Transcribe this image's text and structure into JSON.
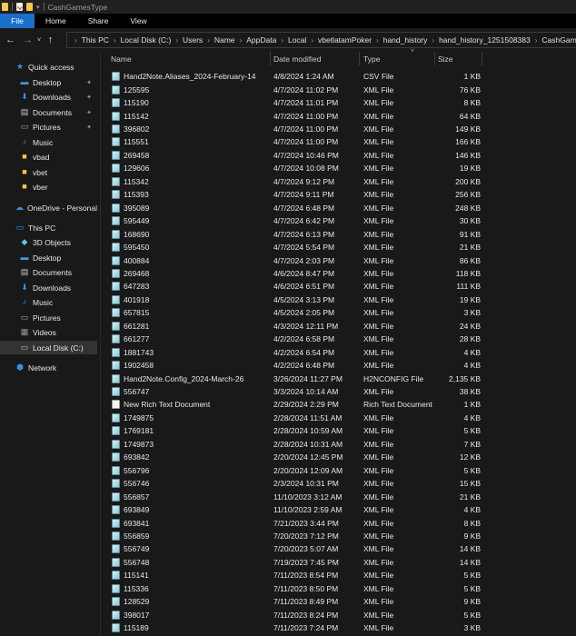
{
  "window": {
    "title": "CashGamesType"
  },
  "ribbon": {
    "tabs": [
      "File",
      "Home",
      "Share",
      "View"
    ]
  },
  "address": {
    "crumbs": [
      "This PC",
      "Local Disk (C:)",
      "Users",
      "Name",
      "AppData",
      "Local",
      "vbetlatamPoker",
      "hand_history",
      "hand_history_1251508383",
      "CashGamesType"
    ]
  },
  "sidebar": {
    "items": [
      {
        "label": "Quick access",
        "icon": "star-icon",
        "level": 0
      },
      {
        "label": "Desktop",
        "icon": "desktop-icon",
        "level": 1,
        "pinned": true
      },
      {
        "label": "Downloads",
        "icon": "download-icon",
        "level": 1,
        "pinned": true
      },
      {
        "label": "Documents",
        "icon": "documents-icon",
        "level": 1,
        "pinned": true
      },
      {
        "label": "Pictures",
        "icon": "pictures-icon",
        "level": 1,
        "pinned": true
      },
      {
        "label": "Music",
        "icon": "music-icon",
        "level": 1
      },
      {
        "label": "vbad",
        "icon": "folder-icon",
        "level": 1
      },
      {
        "label": "vbet",
        "icon": "folder-icon",
        "level": 1
      },
      {
        "label": "vber",
        "icon": "folder-icon",
        "level": 1
      },
      {
        "label": "OneDrive - Personal",
        "icon": "cloud-icon",
        "level": 0
      },
      {
        "label": "This PC",
        "icon": "computer-icon",
        "level": 0
      },
      {
        "label": "3D Objects",
        "icon": "cube-icon",
        "level": 1
      },
      {
        "label": "Desktop",
        "icon": "desktop-icon",
        "level": 1
      },
      {
        "label": "Documents",
        "icon": "documents-icon",
        "level": 1
      },
      {
        "label": "Downloads",
        "icon": "download-icon",
        "level": 1
      },
      {
        "label": "Music",
        "icon": "music-icon",
        "level": 1
      },
      {
        "label": "Pictures",
        "icon": "pictures-icon",
        "level": 1
      },
      {
        "label": "Videos",
        "icon": "videos-icon",
        "level": 1
      },
      {
        "label": "Local Disk (C:)",
        "icon": "drive-icon",
        "level": 1,
        "selected": true
      },
      {
        "label": "Network",
        "icon": "network-icon",
        "level": 0
      }
    ]
  },
  "columns": {
    "name": "Name",
    "date": "Date modified",
    "type": "Type",
    "size": "Size"
  },
  "files": [
    [
      "Hand2Note.Aliases_2024-February-14",
      "4/8/2024 1:24 AM",
      "CSV File",
      "1 KB"
    ],
    [
      "125595",
      "4/7/2024 11:02 PM",
      "XML File",
      "76 KB"
    ],
    [
      "115190",
      "4/7/2024 11:01 PM",
      "XML File",
      "8 KB"
    ],
    [
      "115142",
      "4/7/2024 11:00 PM",
      "XML File",
      "64 KB"
    ],
    [
      "396802",
      "4/7/2024 11:00 PM",
      "XML File",
      "149 KB"
    ],
    [
      "115551",
      "4/7/2024 11:00 PM",
      "XML File",
      "166 KB"
    ],
    [
      "269458",
      "4/7/2024 10:46 PM",
      "XML File",
      "146 KB"
    ],
    [
      "129606",
      "4/7/2024 10:08 PM",
      "XML File",
      "19 KB"
    ],
    [
      "115342",
      "4/7/2024 9:12 PM",
      "XML File",
      "200 KB"
    ],
    [
      "115393",
      "4/7/2024 9:11 PM",
      "XML File",
      "256 KB"
    ],
    [
      "395089",
      "4/7/2024 6:48 PM",
      "XML File",
      "248 KB"
    ],
    [
      "595449",
      "4/7/2024 6:42 PM",
      "XML File",
      "30 KB"
    ],
    [
      "168690",
      "4/7/2024 6:13 PM",
      "XML File",
      "91 KB"
    ],
    [
      "595450",
      "4/7/2024 5:54 PM",
      "XML File",
      "21 KB"
    ],
    [
      "400884",
      "4/7/2024 2:03 PM",
      "XML File",
      "86 KB"
    ],
    [
      "269468",
      "4/6/2024 8:47 PM",
      "XML File",
      "118 KB"
    ],
    [
      "647283",
      "4/6/2024 6:51 PM",
      "XML File",
      "111 KB"
    ],
    [
      "401918",
      "4/5/2024 3:13 PM",
      "XML File",
      "19 KB"
    ],
    [
      "657815",
      "4/5/2024 2:05 PM",
      "XML File",
      "3 KB"
    ],
    [
      "661281",
      "4/3/2024 12:11 PM",
      "XML File",
      "24 KB"
    ],
    [
      "661277",
      "4/2/2024 6:58 PM",
      "XML File",
      "28 KB"
    ],
    [
      "1881743",
      "4/2/2024 6:54 PM",
      "XML File",
      "4 KB"
    ],
    [
      "1902458",
      "4/2/2024 6:48 PM",
      "XML File",
      "4 KB"
    ],
    [
      "Hand2Note.Config_2024-March-26",
      "3/26/2024 11:27 PM",
      "H2NCONFIG File",
      "2,135 KB"
    ],
    [
      "556747",
      "3/3/2024 10:14 AM",
      "XML File",
      "38 KB"
    ],
    [
      "New Rich Text Document",
      "2/29/2024 2:29 PM",
      "Rich Text Document",
      "1 KB"
    ],
    [
      "1749875",
      "2/28/2024 11:51 AM",
      "XML File",
      "4 KB"
    ],
    [
      "1769181",
      "2/28/2024 10:59 AM",
      "XML File",
      "5 KB"
    ],
    [
      "1749873",
      "2/28/2024 10:31 AM",
      "XML File",
      "7 KB"
    ],
    [
      "693842",
      "2/20/2024 12:45 PM",
      "XML File",
      "12 KB"
    ],
    [
      "556796",
      "2/20/2024 12:09 AM",
      "XML File",
      "5 KB"
    ],
    [
      "556746",
      "2/3/2024 10:31 PM",
      "XML File",
      "15 KB"
    ],
    [
      "556857",
      "11/10/2023 3:12 AM",
      "XML File",
      "21 KB"
    ],
    [
      "693849",
      "11/10/2023 2:59 AM",
      "XML File",
      "4 KB"
    ],
    [
      "693841",
      "7/21/2023 3:44 PM",
      "XML File",
      "8 KB"
    ],
    [
      "556859",
      "7/20/2023 7:12 PM",
      "XML File",
      "9 KB"
    ],
    [
      "556749",
      "7/20/2023 5:07 AM",
      "XML File",
      "14 KB"
    ],
    [
      "556748",
      "7/19/2023 7:45 PM",
      "XML File",
      "14 KB"
    ],
    [
      "115141",
      "7/11/2023 8:54 PM",
      "XML File",
      "5 KB"
    ],
    [
      "115336",
      "7/11/2023 8:50 PM",
      "XML File",
      "5 KB"
    ],
    [
      "128529",
      "7/11/2023 8:49 PM",
      "XML File",
      "9 KB"
    ],
    [
      "398017",
      "7/11/2023 8:24 PM",
      "XML File",
      "5 KB"
    ],
    [
      "115189",
      "7/11/2023 7:24 PM",
      "XML File",
      "3 KB"
    ]
  ]
}
